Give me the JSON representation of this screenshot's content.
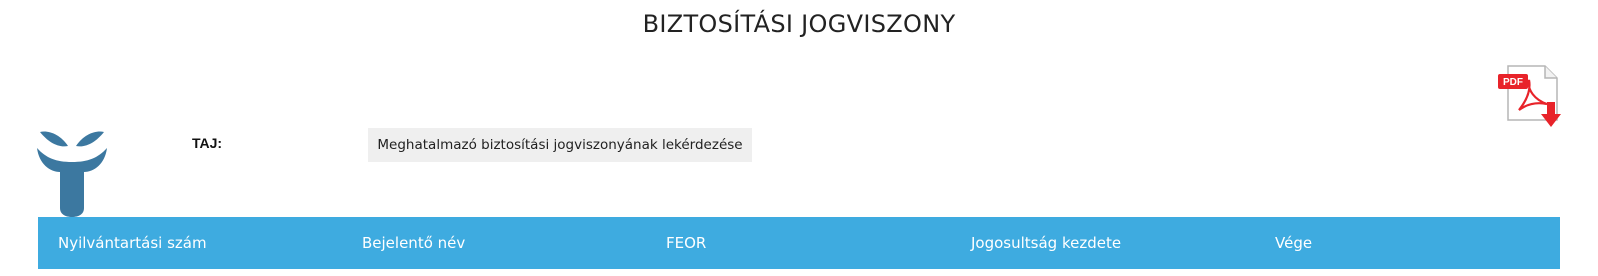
{
  "header": {
    "title": "BIZTOSÍTÁSI JOGVISZONY"
  },
  "icons": {
    "pdf": "pdf-download-icon",
    "logo": "agency-logo-icon",
    "pdf_badge_text": "PDF"
  },
  "form": {
    "taj_label": "TAJ:",
    "query_button_label": "Meghatalmazó biztosítási jogviszonyának lekérdezése"
  },
  "table": {
    "columns": [
      "Nyilvántartási szám",
      "Bejelentő név",
      "FEOR",
      "Jogosultság kezdete",
      "Vége"
    ]
  },
  "colors": {
    "table_header_bg": "#3eabe0",
    "logo_blue": "#3c78a0",
    "pdf_red": "#e8232a"
  }
}
